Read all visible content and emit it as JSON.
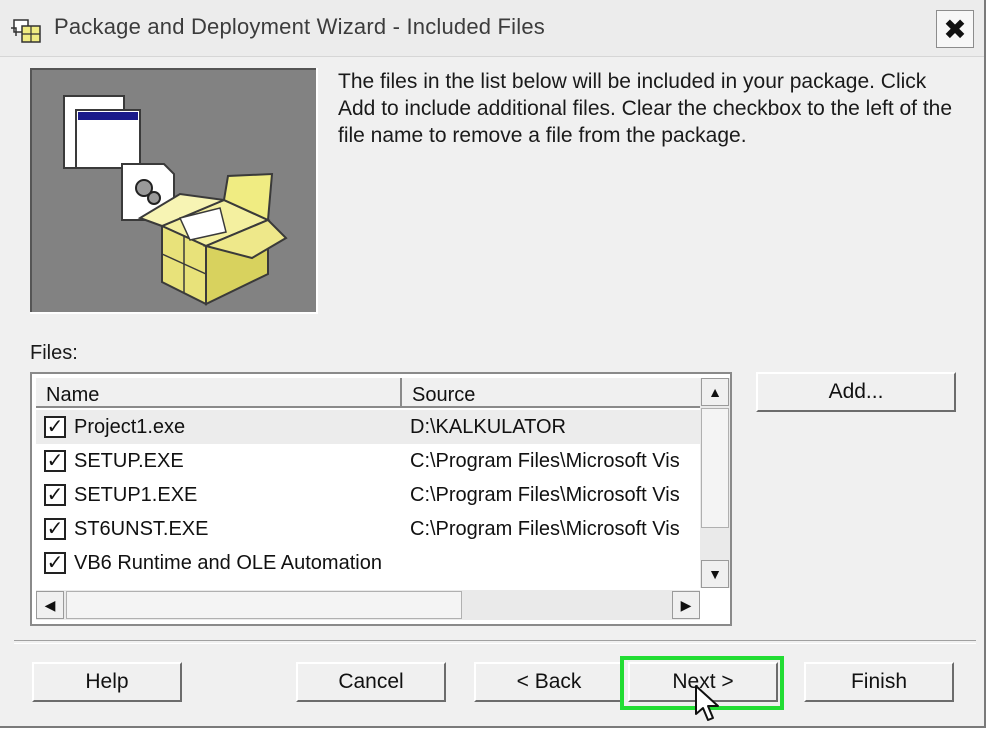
{
  "window": {
    "title": "Package and Deployment Wizard - Included Files",
    "close_label": "✖"
  },
  "intro_text": "The files in the list below will be included in your package. Click Add to include additional files. Clear the checkbox to the left of the file name to remove a file from the package.",
  "files_label": "Files:",
  "columns": {
    "name": "Name",
    "source": "Source"
  },
  "files": [
    {
      "checked": true,
      "name": "Project1.exe",
      "source": "D:\\KALKULATOR"
    },
    {
      "checked": true,
      "name": "SETUP.EXE",
      "source": "C:\\Program Files\\Microsoft Vis"
    },
    {
      "checked": true,
      "name": "SETUP1.EXE",
      "source": "C:\\Program Files\\Microsoft Vis"
    },
    {
      "checked": true,
      "name": "ST6UNST.EXE",
      "source": "C:\\Program Files\\Microsoft Vis"
    },
    {
      "checked": true,
      "name": "VB6 Runtime and OLE Automation",
      "source": ""
    }
  ],
  "buttons": {
    "add": "Add...",
    "help": "Help",
    "cancel": "Cancel",
    "back": "< Back",
    "next": "Next >",
    "finish": "Finish"
  },
  "colors": {
    "dialog_bg": "#f0f0f0",
    "illustration_bg": "#828282",
    "highlight_border": "#22dd33",
    "box_yellow": "#f0ec82"
  },
  "icons": {
    "app": "setup-box-icon",
    "scroll_up": "arrow-up-icon",
    "scroll_down": "arrow-down-icon",
    "scroll_left": "arrow-left-icon",
    "scroll_right": "arrow-right-icon",
    "pointer": "mouse-pointer-icon"
  }
}
